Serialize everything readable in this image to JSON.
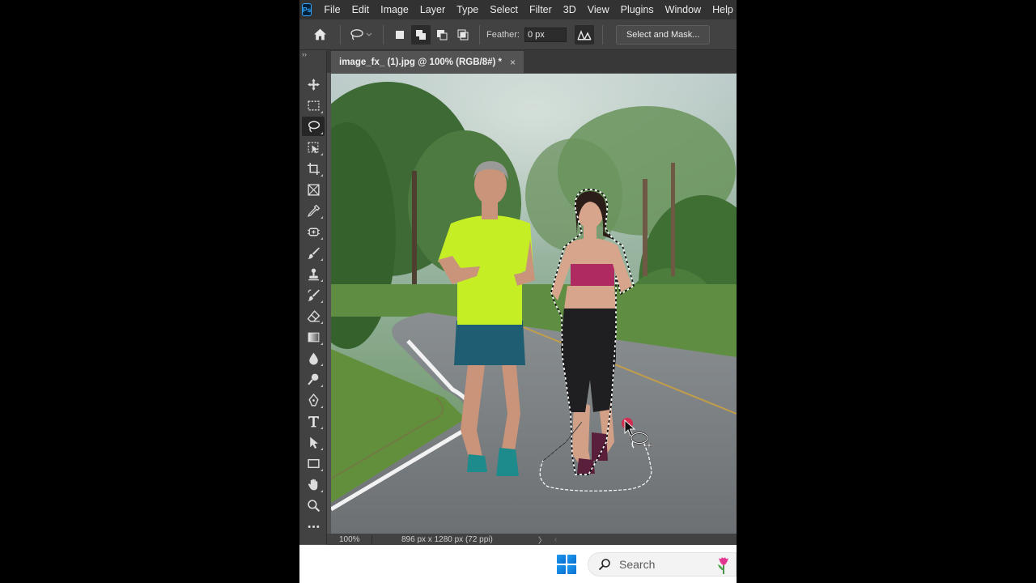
{
  "menu": {
    "items": [
      "File",
      "Edit",
      "Image",
      "Layer",
      "Type",
      "Select",
      "Filter",
      "3D",
      "View",
      "Plugins",
      "Window",
      "Help"
    ]
  },
  "app": {
    "logo_text": "Ps"
  },
  "options": {
    "feather_label": "Feather:",
    "feather_value": "0 px",
    "select_mask_label": "Select and Mask..."
  },
  "toolbar": {
    "collapse": "››"
  },
  "document": {
    "tab_title": "image_fx_ (1).jpg @ 100% (RGB/8#) *",
    "close_glyph": "×"
  },
  "status": {
    "zoom": "100%",
    "doc_info": "896 px x 1280 px (72 ppi)",
    "arrow": "〉",
    "scroll": "‹"
  },
  "taskbar": {
    "search_placeholder": "Search"
  },
  "colors": {
    "ps_blue": "#31a8ff",
    "panel_dark": "#323232",
    "panel_mid": "#424242",
    "workspace": "#535353"
  }
}
